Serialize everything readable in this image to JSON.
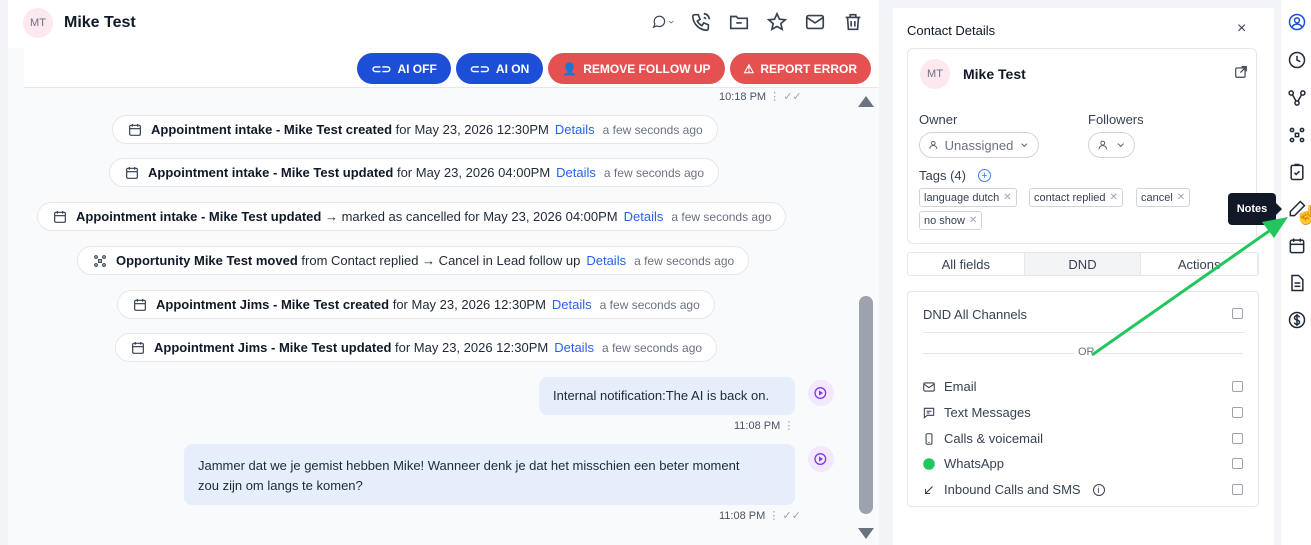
{
  "conversation": {
    "contact_initials": "MT",
    "contact_name": "Mike Test",
    "header_icons": [
      "chat-bubble-icon",
      "phone-icon",
      "folder-icon",
      "star-icon",
      "mail-icon",
      "trash-icon"
    ],
    "buttons": {
      "ai_off": "AI OFF",
      "ai_on": "AI ON",
      "remove_follow_up": "REMOVE FOLLOW UP",
      "report_error": "REPORT ERROR"
    },
    "top_timestamp": "10:18 PM",
    "events": [
      {
        "bold": "Appointment intake - Mike Test created",
        "text": "for May 23, 2026 12:30PM",
        "details": "Details",
        "ago": "a few seconds ago"
      },
      {
        "bold": "Appointment intake - Mike Test updated",
        "text": "for May 23, 2026 04:00PM",
        "details": "Details",
        "ago": "a few seconds ago"
      },
      {
        "bold": "Appointment intake - Mike Test updated",
        "text": "→ marked as cancelled for May 23, 2026 04:00PM",
        "details": "Details",
        "ago": "a few seconds ago"
      },
      {
        "bold": "Opportunity Mike Test moved",
        "text": "from Contact replied → Cancel in Lead follow up",
        "details": "Details",
        "ago": "a few seconds ago"
      },
      {
        "bold": "Appointment Jims - Mike Test created",
        "text": "for May 23, 2026 12:30PM",
        "details": "Details",
        "ago": "a few seconds ago"
      },
      {
        "bold": "Appointment Jims - Mike Test updated",
        "text": "for May 23, 2026 12:30PM",
        "details": "Details",
        "ago": "a few seconds ago"
      }
    ],
    "messages": [
      {
        "text": "Internal notification:The AI is back on.",
        "time": "11:08 PM"
      },
      {
        "text_line1": "Jammer dat we je gemist hebben Mike! Wanneer denk je dat het misschien een beter moment",
        "text_line2": "zou zijn om langs te komen?",
        "time": "11:08 PM"
      }
    ]
  },
  "contact_details": {
    "title": "Contact Details",
    "close": "×",
    "initials": "MT",
    "name": "Mike Test",
    "owner_label": "Owner",
    "owner_value": "Unassigned",
    "followers_label": "Followers",
    "tags_label": "Tags (4)",
    "tags": [
      "language dutch",
      "contact replied",
      "cancel",
      "no show"
    ],
    "tabs": [
      "All fields",
      "DND",
      "Actions"
    ],
    "active_tab": "DND",
    "dnd_all": "DND All Channels",
    "or": "OR",
    "channels": [
      "Email",
      "Text Messages",
      "Calls & voicemail",
      "WhatsApp",
      "Inbound Calls and SMS"
    ]
  },
  "rail": {
    "icons": [
      "user-circle-icon",
      "clock-icon",
      "workflow-icon",
      "opportunity-icon",
      "task-icon",
      "notes-icon",
      "calendar-icon",
      "document-icon",
      "dollar-icon"
    ],
    "tooltip": "Notes"
  },
  "colors": {
    "primary_blue": "#1d4ed8",
    "danger_red": "#e55151",
    "annotation_green": "#22c55e",
    "link_blue": "#2563eb"
  }
}
